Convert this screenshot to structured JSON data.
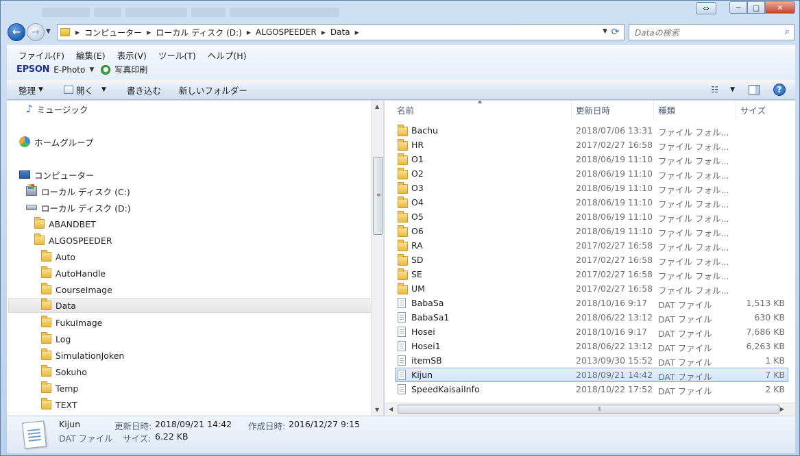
{
  "window": {
    "min_glyph": "─",
    "max_glyph": "□",
    "close_glyph": "✕",
    "restore_glyph": "⇔"
  },
  "nav": {
    "back_glyph": "←",
    "forward_glyph": "→",
    "breadcrumbs": [
      "コンピューター",
      "ローカル ディスク (D:)",
      "ALGOSPEEDER",
      "Data"
    ],
    "search_placeholder": "Dataの検索"
  },
  "menu": {
    "items": [
      "ファイル(F)",
      "編集(E)",
      "表示(V)",
      "ツール(T)",
      "ヘルプ(H)"
    ],
    "epson_logo": "EPSON",
    "ephoto_label": "E-Photo",
    "photo_print_label": "写真印刷"
  },
  "commands": {
    "organize": "整理",
    "open": "開く",
    "burn": "書き込む",
    "new_folder": "新しいフォルダー"
  },
  "nav_pane": {
    "music": "ミュージック",
    "homegroup": "ホームグループ",
    "computer": "コンピューター",
    "drive_c": "ローカル ディスク (C:)",
    "drive_d": "ローカル ディスク (D:)",
    "d_folders": [
      "ABANDBET",
      "ALGOSPEEDER"
    ],
    "algospeeder_children": [
      "Auto",
      "AutoHandle",
      "CourseImage",
      "Data",
      "FukuImage",
      "Log",
      "SimulationJoken",
      "Sokuho",
      "Temp",
      "TEXT"
    ],
    "selected_folder": "Data"
  },
  "columns": {
    "name": "名前",
    "date": "更新日時",
    "type": "種類",
    "size": "サイズ"
  },
  "files": [
    {
      "name": "Bachu",
      "date": "2018/07/06 13:31",
      "type": "ファイル フォル...",
      "size": "",
      "kind": "folder"
    },
    {
      "name": "HR",
      "date": "2017/02/27 16:58",
      "type": "ファイル フォル...",
      "size": "",
      "kind": "folder"
    },
    {
      "name": "O1",
      "date": "2018/06/19 11:10",
      "type": "ファイル フォル...",
      "size": "",
      "kind": "folder"
    },
    {
      "name": "O2",
      "date": "2018/06/19 11:10",
      "type": "ファイル フォル...",
      "size": "",
      "kind": "folder"
    },
    {
      "name": "O3",
      "date": "2018/06/19 11:10",
      "type": "ファイル フォル...",
      "size": "",
      "kind": "folder"
    },
    {
      "name": "O4",
      "date": "2018/06/19 11:10",
      "type": "ファイル フォル...",
      "size": "",
      "kind": "folder"
    },
    {
      "name": "O5",
      "date": "2018/06/19 11:10",
      "type": "ファイル フォル...",
      "size": "",
      "kind": "folder"
    },
    {
      "name": "O6",
      "date": "2018/06/19 11:10",
      "type": "ファイル フォル...",
      "size": "",
      "kind": "folder"
    },
    {
      "name": "RA",
      "date": "2017/02/27 16:58",
      "type": "ファイル フォル...",
      "size": "",
      "kind": "folder"
    },
    {
      "name": "SD",
      "date": "2017/02/27 16:58",
      "type": "ファイル フォル...",
      "size": "",
      "kind": "folder"
    },
    {
      "name": "SE",
      "date": "2017/02/27 16:58",
      "type": "ファイル フォル...",
      "size": "",
      "kind": "folder"
    },
    {
      "name": "UM",
      "date": "2017/02/27 16:58",
      "type": "ファイル フォル...",
      "size": "",
      "kind": "folder"
    },
    {
      "name": "BabaSa",
      "date": "2018/10/16 9:17",
      "type": "DAT ファイル",
      "size": "1,513 KB",
      "kind": "dat"
    },
    {
      "name": "BabaSa1",
      "date": "2018/06/22 13:12",
      "type": "DAT ファイル",
      "size": "630 KB",
      "kind": "dat"
    },
    {
      "name": "Hosei",
      "date": "2018/10/16 9:17",
      "type": "DAT ファイル",
      "size": "7,686 KB",
      "kind": "dat"
    },
    {
      "name": "Hosei1",
      "date": "2018/06/22 13:12",
      "type": "DAT ファイル",
      "size": "6,263 KB",
      "kind": "dat"
    },
    {
      "name": "itemSB",
      "date": "2013/09/30 15:52",
      "type": "DAT ファイル",
      "size": "1 KB",
      "kind": "dat"
    },
    {
      "name": "Kijun",
      "date": "2018/09/21 14:42",
      "type": "DAT ファイル",
      "size": "7 KB",
      "kind": "dat",
      "selected": true
    },
    {
      "name": "SpeedKaisaiInfo",
      "date": "2018/10/22 17:52",
      "type": "DAT ファイル",
      "size": "2 KB",
      "kind": "dat"
    }
  ],
  "details": {
    "name": "Kijun",
    "type": "DAT ファイル",
    "modified_label": "更新日時:",
    "modified_value": "2018/09/21 14:42",
    "created_label": "作成日時:",
    "created_value": "2016/12/27 9:15",
    "size_label": "サイズ:",
    "size_value": "6.22 KB"
  }
}
